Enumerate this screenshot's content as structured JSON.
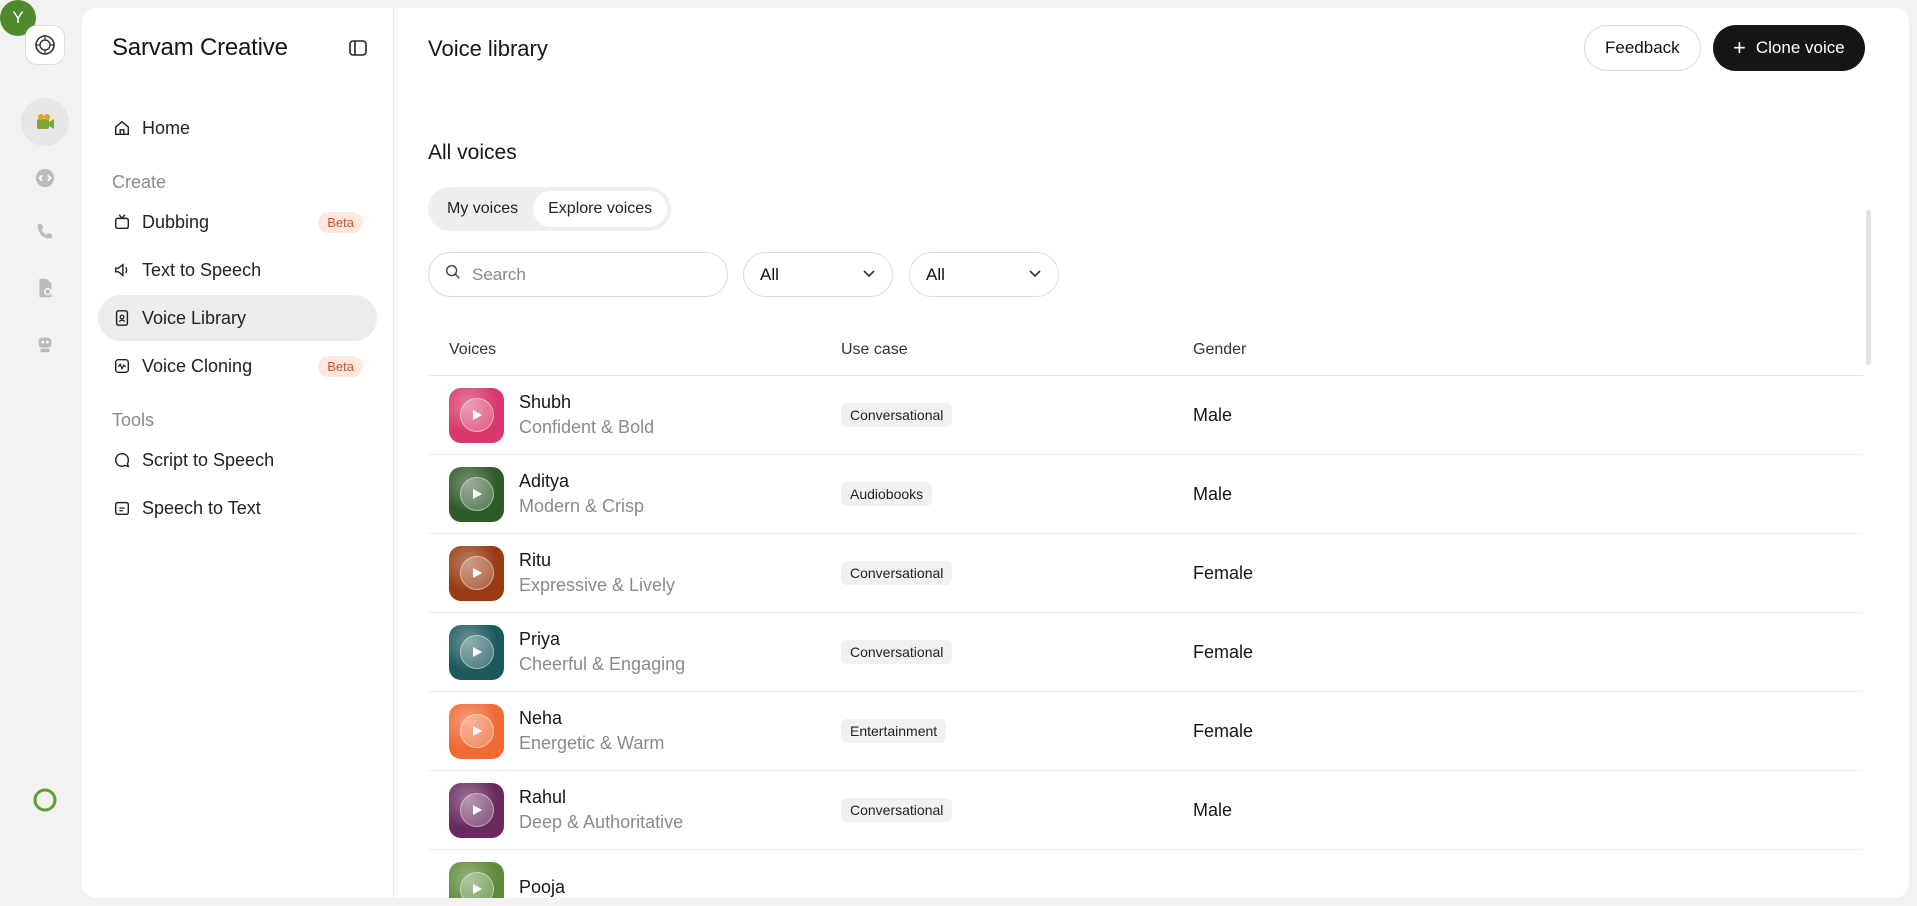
{
  "app": {
    "title": "Sarvam Creative",
    "avatar_letter": "Y"
  },
  "nav": {
    "home": "Home",
    "section_create": "Create",
    "dubbing": "Dubbing",
    "dubbing_badge": "Beta",
    "tts": "Text to Speech",
    "voice_library": "Voice Library",
    "voice_cloning": "Voice Cloning",
    "voice_cloning_badge": "Beta",
    "section_tools": "Tools",
    "script_to_speech": "Script to Speech",
    "speech_to_text": "Speech to Text"
  },
  "header": {
    "title": "Voice library",
    "feedback": "Feedback",
    "clone": "Clone voice"
  },
  "main": {
    "section_title": "All voices",
    "tabs": [
      {
        "label": "My voices"
      },
      {
        "label": "Explore voices"
      }
    ],
    "active_tab": 1,
    "search_placeholder": "Search",
    "filter1": "All",
    "filter2": "All"
  },
  "table": {
    "headers": {
      "voices": "Voices",
      "use_case": "Use case",
      "gender": "Gender"
    },
    "rows": [
      {
        "name": "Shubh",
        "desc": "Confident & Bold",
        "use_case": "Conversational",
        "gender": "Male",
        "color": "#d8386a"
      },
      {
        "name": "Aditya",
        "desc": "Modern & Crisp",
        "use_case": "Audiobooks",
        "gender": "Male",
        "color": "#2f5a2a"
      },
      {
        "name": "Ritu",
        "desc": "Expressive & Lively",
        "use_case": "Conversational",
        "gender": "Female",
        "color": "#9a3a12"
      },
      {
        "name": "Priya",
        "desc": "Cheerful & Engaging",
        "use_case": "Conversational",
        "gender": "Female",
        "color": "#1c5a5e"
      },
      {
        "name": "Neha",
        "desc": "Energetic & Warm",
        "use_case": "Entertainment",
        "gender": "Female",
        "color": "#f06a34"
      },
      {
        "name": "Rahul",
        "desc": "Deep & Authoritative",
        "use_case": "Conversational",
        "gender": "Male",
        "color": "#6a2a5e"
      },
      {
        "name": "Pooja",
        "desc": "",
        "use_case": "",
        "gender": "",
        "color": "#5e8a3a"
      }
    ]
  },
  "colors": {
    "accent": "#161616",
    "badge_bg": "#fde8df",
    "badge_text": "#d2502a",
    "progress": "#5ea02e"
  }
}
